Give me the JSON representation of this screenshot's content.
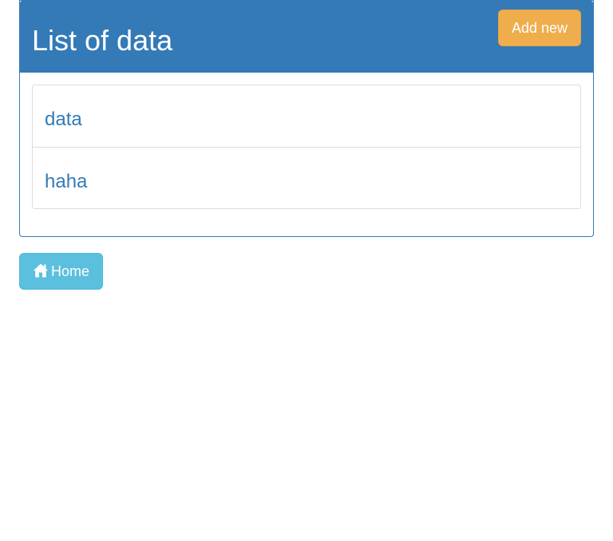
{
  "panel": {
    "title": "List of data",
    "add_button_label": "Add new",
    "items": [
      {
        "label": "data"
      },
      {
        "label": "haha"
      }
    ]
  },
  "home_button": {
    "label": "Home",
    "icon": "home-icon"
  },
  "colors": {
    "primary": "#337ab7",
    "warning": "#f0ad4e",
    "info": "#5bc0de",
    "border": "#dddddd"
  }
}
